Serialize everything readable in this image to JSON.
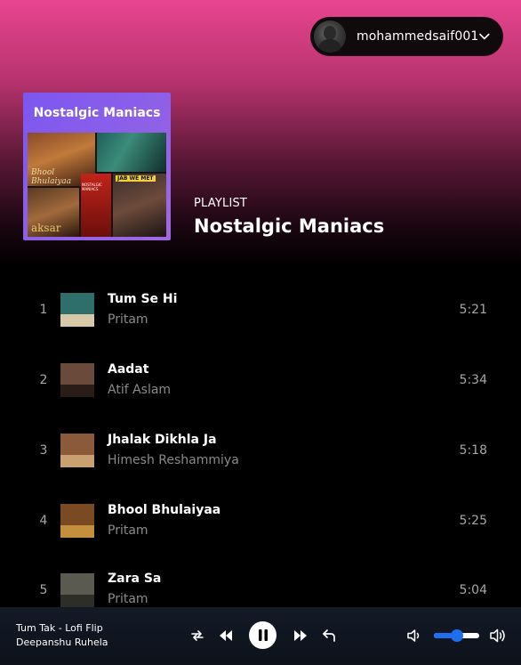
{
  "user": {
    "username": "mohammedsaif001"
  },
  "playlist": {
    "type_label": "PLAYLIST",
    "title": "Nostalgic Maniacs",
    "cover": {
      "title": "Nostalgic Maniacs",
      "labels": [
        "Bhool Bhulaiyaa",
        "aksar",
        "JAB WE MET",
        "NOSTALGIC MANIACS"
      ]
    }
  },
  "tracks": [
    {
      "num": "1",
      "name": "Tum Se Hi",
      "artist": "Pritam",
      "duration": "5:21",
      "colors": [
        "#2f6f6b",
        "#d7c9a8"
      ]
    },
    {
      "num": "2",
      "name": "Aadat",
      "artist": "Atif Aslam",
      "duration": "5:34",
      "colors": [
        "#6a4a3a",
        "#2a1c16"
      ]
    },
    {
      "num": "3",
      "name": "Jhalak Dikhla Ja",
      "artist": "Himesh Reshammiya",
      "duration": "5:18",
      "colors": [
        "#8a5a3a",
        "#c9a070"
      ]
    },
    {
      "num": "4",
      "name": "Bhool Bhulaiyaa",
      "artist": "Pritam",
      "duration": "5:25",
      "colors": [
        "#7a4a22",
        "#c5903e"
      ]
    },
    {
      "num": "5",
      "name": "Zara Sa",
      "artist": "Pritam",
      "duration": "5:04",
      "colors": [
        "#5a5a50",
        "#2e2e28"
      ]
    }
  ],
  "now_playing": {
    "title": "Tum Tak - Lofi Flip",
    "artist": "Deepanshu Ruhela"
  },
  "player": {
    "volume_fraction": 0.5
  },
  "colors": {
    "accent": "#1e6ff0",
    "hero_top": "#e8458f"
  }
}
